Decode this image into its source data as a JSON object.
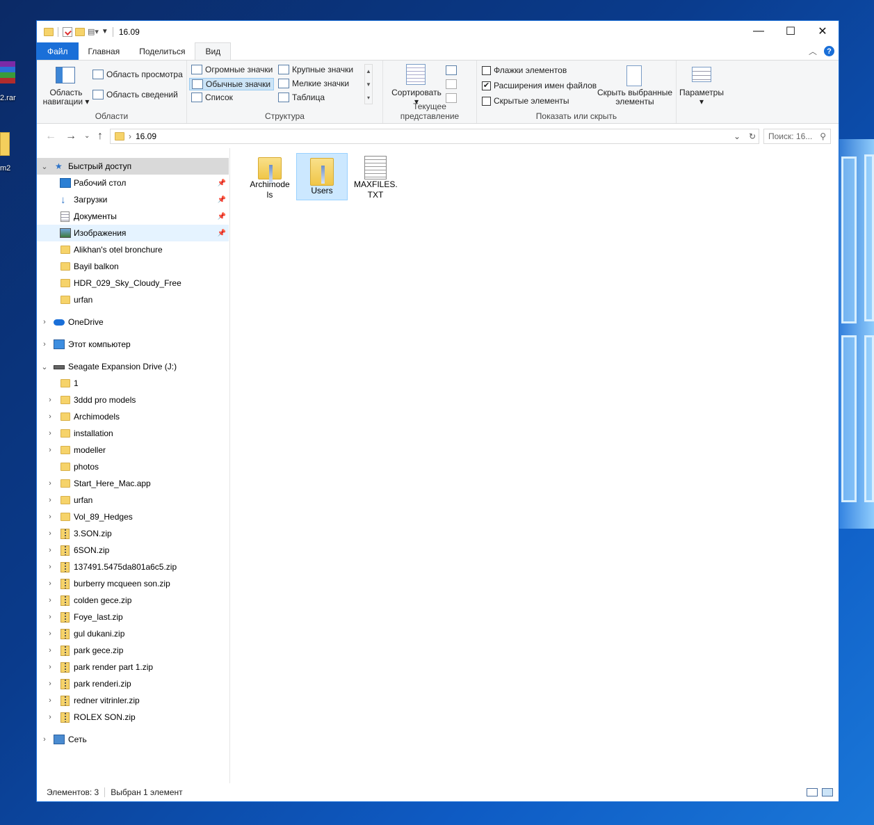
{
  "desktop": {
    "icon1_label": "2.rar",
    "icon2_label": "m2"
  },
  "title": "16.09",
  "window_buttons": {
    "minimize": "—",
    "maximize": "☐",
    "close": "✕"
  },
  "tabs": [
    {
      "label": "Файл"
    },
    {
      "label": "Главная"
    },
    {
      "label": "Поделиться"
    },
    {
      "label": "Вид"
    }
  ],
  "ribbon": {
    "panes": {
      "nav_pane_label_1": "Область",
      "nav_pane_label_2": "навигации",
      "preview_pane": "Область просмотра",
      "details_pane": "Область сведений",
      "group_label": "Области"
    },
    "layout": {
      "items": [
        "Огромные значки",
        "Крупные значки",
        "Обычные значки",
        "Мелкие значки",
        "Список",
        "Таблица"
      ],
      "group_label": "Структура"
    },
    "current_view": {
      "sort": "Сортировать",
      "group_label": "Текущее представление"
    },
    "show_hide": {
      "item_checkboxes": "Флажки элементов",
      "file_extensions": "Расширения имен файлов",
      "hidden_items": "Скрытые элементы",
      "hide_selected_1": "Скрыть выбранные",
      "hide_selected_2": "элементы",
      "group_label": "Показать или скрыть",
      "checked": "✔"
    },
    "options": {
      "label": "Параметры"
    }
  },
  "address": {
    "path": "16.09",
    "search_placeholder": "Поиск: 16..."
  },
  "nav": {
    "quick_access": "Быстрый доступ",
    "quick_items": [
      "Рабочий стол",
      "Загрузки",
      "Документы",
      "Изображения"
    ],
    "quick_folders": [
      "Alikhan's otel bronchure",
      "Bayil balkon",
      "HDR_029_Sky_Cloudy_Free",
      "urfan"
    ],
    "onedrive": "OneDrive",
    "this_pc": "Этот компьютер",
    "drive": "Seagate Expansion Drive (J:)",
    "drive_folders": [
      "1",
      "3ddd pro models",
      "Archimodels",
      "installation",
      "modeller",
      "photos",
      "Start_Here_Mac.app",
      "urfan",
      "Vol_89_Hedges"
    ],
    "drive_zips": [
      "3.SON.zip",
      "6SON.zip",
      "137491.5475da801a6c5.zip",
      "burberry mcqueen son.zip",
      "colden gece.zip",
      "Foye_last.zip",
      "gul dukani.zip",
      "park gece.zip",
      "park render part 1.zip",
      "park renderi.zip",
      "redner vitrinler.zip",
      "ROLEX SON.zip"
    ],
    "network": "Сеть"
  },
  "files": [
    {
      "name": "Archimode ls",
      "type": "folder"
    },
    {
      "name": "Users",
      "type": "folder",
      "selected": true
    },
    {
      "name": "MAXFILES. TXT",
      "type": "text"
    }
  ],
  "status": {
    "count": "Элементов: 3",
    "selected": "Выбран 1 элемент"
  },
  "colors": {
    "accent": "#1a6fd8",
    "selection": "#cce8ff",
    "nav_header": "#d9d9d9"
  }
}
